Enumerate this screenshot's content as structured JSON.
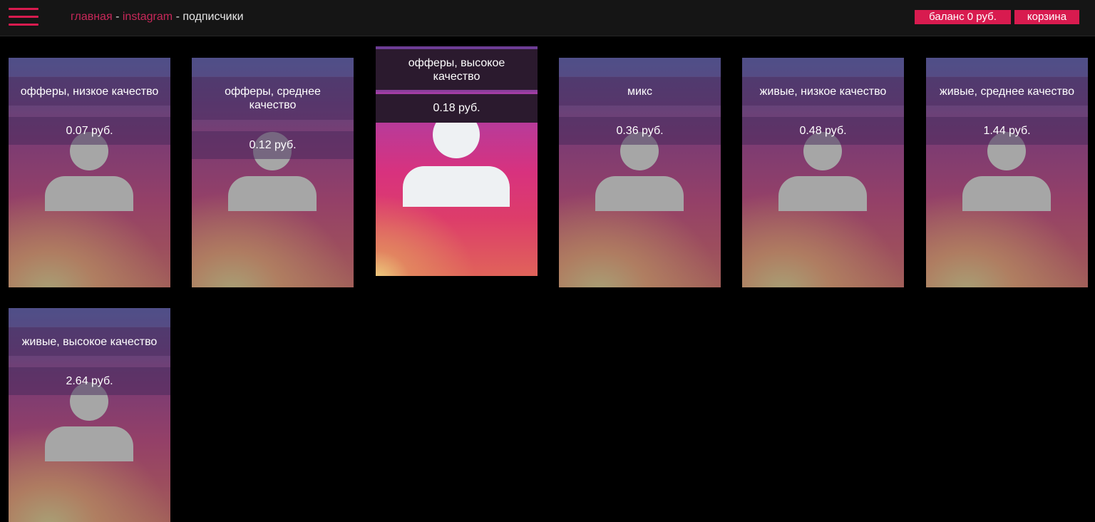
{
  "header": {
    "breadcrumb": {
      "home": "главная",
      "separator": "-",
      "section": "instagram",
      "current": "подписчики"
    },
    "balance_label": "баланс 0 руб.",
    "cart_label": "корзина",
    "menu_icon": "hamburger-menu-icon",
    "accent_color": "#d81b4f"
  },
  "cards": [
    {
      "title": "офферы, низкое качество",
      "price": "0.07 руб."
    },
    {
      "title": "офферы, среднее качество",
      "price": "0.12 руб."
    },
    {
      "title": "офферы, высокое качество",
      "price": "0.18 руб.",
      "highlighted": true
    },
    {
      "title": "микс",
      "price": "0.36 руб."
    },
    {
      "title": "живые, низкое качество",
      "price": "0.48 руб."
    },
    {
      "title": "живые, среднее качество",
      "price": "1.44 руб."
    },
    {
      "title": "живые, высокое качество",
      "price": "2.64 руб."
    }
  ]
}
